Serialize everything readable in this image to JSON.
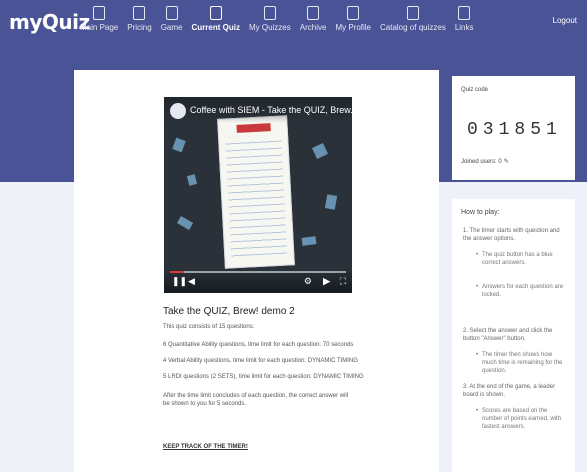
{
  "app": {
    "logo": "myQuiz"
  },
  "nav": [
    {
      "label": "Main Page",
      "icon": "home-icon"
    },
    {
      "label": "Pricing",
      "icon": "price-tag-icon"
    },
    {
      "label": "Game",
      "icon": "gamepad-icon"
    },
    {
      "label": "Current Quiz",
      "icon": "quiz-icon",
      "active": true
    },
    {
      "label": "My Quizzes",
      "icon": "folder-icon"
    },
    {
      "label": "Archive",
      "icon": "archive-icon"
    },
    {
      "label": "My Profile",
      "icon": "user-icon"
    },
    {
      "label": "Catalog of quizzes",
      "icon": "catalog-icon"
    },
    {
      "label": "Links",
      "icon": "link-icon"
    }
  ],
  "header": {
    "logout": "Logout"
  },
  "video": {
    "title": "Coffee with SIEM - Take the QUIZ, Brew..."
  },
  "quiz": {
    "title": "Take the QUIZ, Brew! demo 2",
    "lines": [
      "This quiz consists of 15 questions:",
      "6 Quantitative Ability questions, time limit for each question: 70 seconds",
      "4 Verbal Ability questions, time limit for each question: DYNAMIC TIMING",
      "5 LRDI questions (2 SETS), time limit for each question: DYNAMIC TIMING",
      "After the time limit concludes of each question, the correct answer will be shown to you for 5 seconds."
    ],
    "track": "KEEP TRACK OF THE TIMER!"
  },
  "code_panel": {
    "label": "Quiz code",
    "code": "031851",
    "joined_users": "Joined users: 0"
  },
  "howto": {
    "title": "How to play:",
    "steps": [
      "1. The timer starts with question and the answer options.",
      "2. Select the answer and click the button \"Answer\" button.",
      "3. At the end of the game, a leader board is shown."
    ],
    "subs": [
      "The quiz button has a blue correct answers.",
      "Answers for each question are locked.",
      "The timer then shows how much time is remaining for the question.",
      "Scores are based on the number of points earned, with fastest answers."
    ]
  }
}
